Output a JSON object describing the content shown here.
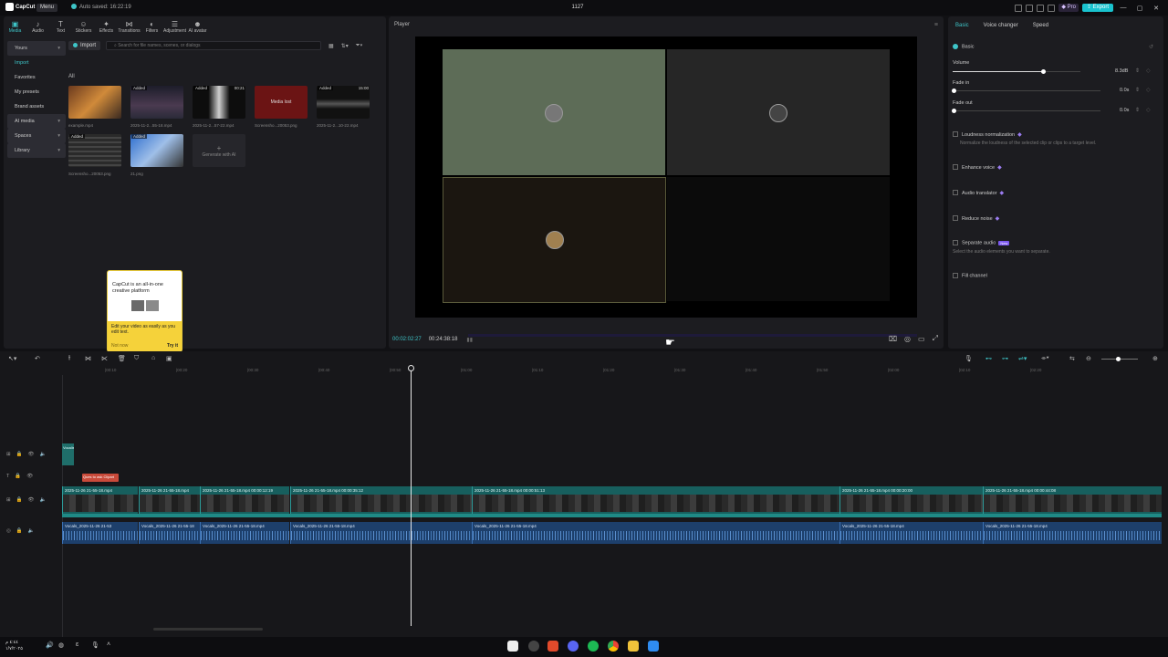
{
  "titlebar": {
    "app_name": "CapCut",
    "menu_label": "Menu",
    "autosave": "Auto saved: 16:22:19",
    "project_title": "1127",
    "pro_label": "Pro",
    "export_label": "Export",
    "accent": "#19c3cf"
  },
  "media": {
    "tabs": [
      {
        "label": "Media",
        "icon": "media-icon"
      },
      {
        "label": "Audio",
        "icon": "audio-icon"
      },
      {
        "label": "Text",
        "icon": "text-icon"
      },
      {
        "label": "Stickers",
        "icon": "stickers-icon"
      },
      {
        "label": "Effects",
        "icon": "effects-icon"
      },
      {
        "label": "Transitions",
        "icon": "transitions-icon"
      },
      {
        "label": "Filters",
        "icon": "filters-icon"
      },
      {
        "label": "Adjustment",
        "icon": "adjustment-icon"
      },
      {
        "label": "AI avatar",
        "icon": "ai-avatar-icon"
      }
    ],
    "sidebar": [
      {
        "label": "Yours"
      },
      {
        "label": "Import"
      },
      {
        "label": "Favorites"
      },
      {
        "label": "My presets"
      },
      {
        "label": "Brand assets"
      },
      {
        "label": "AI media"
      },
      {
        "label": "Spaces"
      },
      {
        "label": "Library"
      }
    ],
    "import_label": "Import",
    "search_placeholder": "Search for file names, scenes, or dialogs",
    "filter_all": "All",
    "items": [
      {
        "name": "example.mp4",
        "badge": "",
        "duration": ""
      },
      {
        "name": "2025-11-2...55-18.mp4",
        "badge": "Added",
        "duration": ""
      },
      {
        "name": "2025-11-2...57-22.mp4",
        "badge": "Added",
        "duration": "00:21"
      },
      {
        "name": "Screensho...20053.png",
        "badge": "",
        "duration": "",
        "overlay": "Media lost"
      },
      {
        "name": "2025-11-2...10-22.mp4",
        "badge": "Added",
        "duration": "15:00"
      },
      {
        "name": "Screensho...20053.png",
        "badge": "Added",
        "duration": ""
      },
      {
        "name": "21.png",
        "badge": "Added",
        "duration": ""
      },
      {
        "name": "",
        "badge": "",
        "duration": "",
        "overlay": "Generate with AI"
      }
    ]
  },
  "tooltip": {
    "heading": "CapCut is an all-in-one creative platform",
    "body": "Edit your video as easily as you edit text.",
    "dismiss": "Not now",
    "action": "Try it"
  },
  "player": {
    "title": "Player",
    "current_time": "00:02:02:27",
    "total_time": "00:24:38:18"
  },
  "properties": {
    "tabs": [
      "Basic",
      "Voice changer",
      "Speed"
    ],
    "basic_label": "Basic",
    "volume": {
      "label": "Volume",
      "value": "8.3dB",
      "level": 0.71
    },
    "fade_in": {
      "label": "Fade in",
      "value": "0.0s"
    },
    "fade_out": {
      "label": "Fade out",
      "value": "0.0s"
    },
    "loudness": {
      "label": "Loudness normalization",
      "desc": "Normalize the loudness of the selected clip or clips to a target level."
    },
    "enhance_voice": "Enhance voice",
    "audio_translator": "Audio translator",
    "reduce_noise": "Reduce noise",
    "separate_audio": {
      "label": "Separate audio",
      "badge": "New",
      "desc": "Select the audio elements you want to separate."
    },
    "fill_channel": "Fill channel"
  },
  "timeline": {
    "ruler": [
      "|00:10",
      "|00:20",
      "|00:30",
      "|00:40",
      "|00:50",
      "|01:00",
      "|01:10",
      "|01:20",
      "|01:30",
      "|01:40",
      "|01:50",
      "|02:00",
      "|02:10",
      "|02:20"
    ],
    "text_clip": "Ques to ask Clipart",
    "sticker_clip": "Vocalist",
    "video_clips": [
      "2025-11-26 21-55-18.mp4",
      "2025-11-26 21-55-18.mp4",
      "2025-11-26 21-55-18.mp4  00:00:12:19",
      "2025-11-26 21-55-18.mp4  00:00:35:12",
      "2025-11-26 21-55-18.mp4  00:00:51:13",
      "2025-11-26 21-55-18.mp4  00:00:20:00",
      "2025-11-26 21-55-18.mp4  00:00:44:08"
    ],
    "audio_clips": [
      "Vocals_2025-11-26 21-53",
      "Vocals_2025-11-26 21-55-18",
      "Vocals_2025-11-26 21-55-18.mp4",
      "Vocals_2025-11-26 21-55-18.mp4",
      "Vocals_2025-11-26 21-55-18.mp4",
      "Vocals_2025-11-26 21-55-18.mp4",
      "Vocals_2025-11-26 21-55-18.mp4"
    ]
  },
  "taskbar": {
    "clock_time": "٤:٤٤ م",
    "clock_date": "١/٧/٢٠٢٥"
  }
}
